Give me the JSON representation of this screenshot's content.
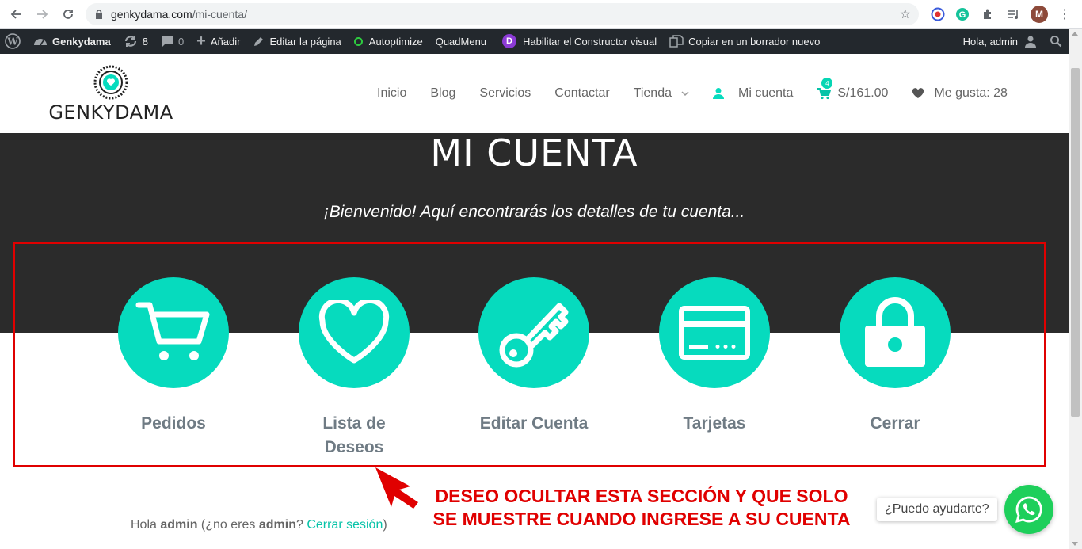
{
  "browser": {
    "url_host": "genkydama.com",
    "url_path": "/mi-cuenta/",
    "profile_initial": "M"
  },
  "adminbar": {
    "site_name": "Genkydama",
    "updates_count": "8",
    "comments_count": "0",
    "add_label": "Añadir",
    "edit_label": "Editar la página",
    "autoptimize_label": "Autoptimize",
    "quadmenu_label": "QuadMenu",
    "divi_badge": "D",
    "builder_label": "Habilitar el Constructor visual",
    "copy_label": "Copiar en un borrador nuevo",
    "greeting": "Hola, admin"
  },
  "header": {
    "logo_text": "GENKYDAMA",
    "menu": [
      "Inicio",
      "Blog",
      "Servicios",
      "Contactar",
      "Tienda"
    ],
    "account_label": "Mi cuenta",
    "cart_count": "4",
    "cart_total": "S/161.00",
    "likes_label": "Me gusta: 28"
  },
  "hero": {
    "title": "MI CUENTA",
    "subtitle": "¡Bienvenido! Aquí encontrarás los detalles de tu cuenta..."
  },
  "cards": [
    {
      "label": "Pedidos",
      "icon": "cart-icon"
    },
    {
      "label_line1": "Lista de",
      "label_line2": "Deseos",
      "icon": "heart-icon"
    },
    {
      "label": "Editar Cuenta",
      "icon": "key-icon"
    },
    {
      "label": "Tarjetas",
      "icon": "credit-card-icon"
    },
    {
      "label": "Cerrar",
      "icon": "padlock-icon"
    }
  ],
  "account_text": {
    "hello": "Hola ",
    "user": "admin",
    "not_you": " (¿no eres ",
    "user2": "admin",
    "q": "? ",
    "logout": "Cerrar sesión",
    "close": ")"
  },
  "annotation": {
    "line1": "DESEO OCULTAR ESTA SECCIÓN Y QUE SOLO",
    "line2": "SE MUESTRE CUANDO INGRESE A SU CUENTA"
  },
  "whatsapp": {
    "bubble": "¿Puedo ayudarte?"
  },
  "colors": {
    "accent": "#06dbbe",
    "hero_bg": "#2b2b2b",
    "annotation": "#e00000",
    "whatsapp": "#1ecf5b"
  }
}
